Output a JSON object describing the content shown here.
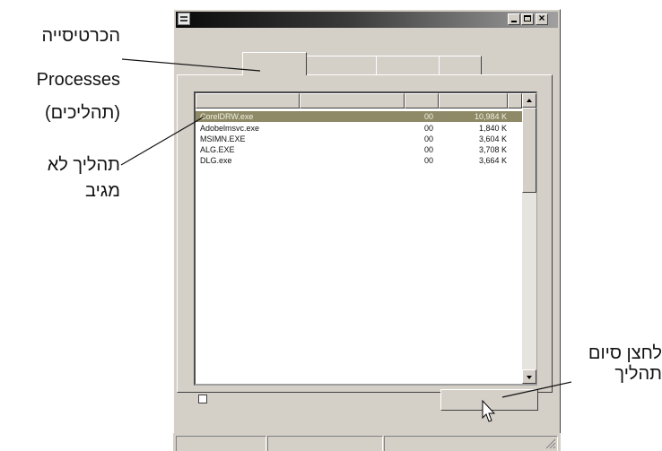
{
  "window": {
    "title_bar_icon": "task-manager-icon",
    "controls": {
      "minimize": "window-minimize-icon",
      "maximize": "window-maximize-icon",
      "close_glyph": "×"
    }
  },
  "process_list": {
    "rows": [
      {
        "name": "CorelDRW.exe",
        "cpu": "00",
        "mem": "10,984 K",
        "selected": true
      },
      {
        "name": "Adobelmsvc.exe",
        "cpu": "00",
        "mem": "1,840 K"
      },
      {
        "name": "MSIMN.EXE",
        "cpu": "00",
        "mem": "3,604 K"
      },
      {
        "name": "ALG.EXE",
        "cpu": "00",
        "mem": "3,708 K"
      },
      {
        "name": "DLG.exe",
        "cpu": "00",
        "mem": "3,664 K"
      }
    ]
  },
  "callouts": {
    "processes_tab": [
      "הכרטיסייה",
      "Processes",
      "(תהליכים)"
    ],
    "hung_process": [
      "תהליך לא",
      "מגיב"
    ],
    "end_process_button": [
      "לחצן סיום",
      "תהליך"
    ]
  },
  "colors": {
    "selected_row": "#8e8a68",
    "window_face": "#d4d0c8",
    "title_dark": "#0a0a0a"
  }
}
